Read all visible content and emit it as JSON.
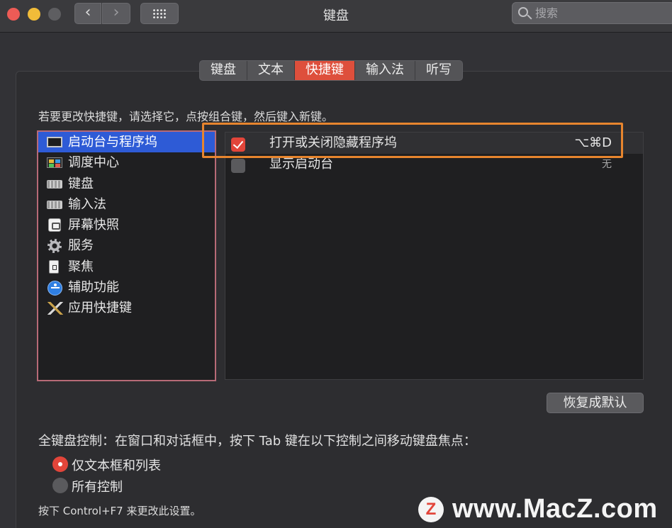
{
  "window": {
    "title": "键盘"
  },
  "search": {
    "placeholder": "搜索"
  },
  "tabs": [
    {
      "label": "键盘"
    },
    {
      "label": "文本"
    },
    {
      "label": "快捷键",
      "active": true
    },
    {
      "label": "输入法"
    },
    {
      "label": "听写"
    }
  ],
  "instruction": "若要更改快捷键，请选择它，点按组合键，然后键入新键。",
  "categories": [
    {
      "label": "启动台与程序坞",
      "icon": "launchpad-icon",
      "selected": true
    },
    {
      "label": "调度中心",
      "icon": "mission-control-icon"
    },
    {
      "label": "键盘",
      "icon": "keyboard-icon"
    },
    {
      "label": "输入法",
      "icon": "keyboard-icon"
    },
    {
      "label": "屏幕快照",
      "icon": "screenshot-icon"
    },
    {
      "label": "服务",
      "icon": "gear-icon"
    },
    {
      "label": "聚焦",
      "icon": "spotlight-icon"
    },
    {
      "label": "辅助功能",
      "icon": "accessibility-icon"
    },
    {
      "label": "应用快捷键",
      "icon": "app-shortcuts-icon"
    }
  ],
  "shortcuts": [
    {
      "label": "打开或关闭隐藏程序坞",
      "key": "⌥⌘D",
      "checked": true
    },
    {
      "label": "显示启动台",
      "key": "无",
      "checked": false
    }
  ],
  "restore_button": "恢复成默认",
  "keyboard_control": {
    "description": "全键盘控制：在窗口和对话框中，按下 Tab 键在以下控制之间移动键盘焦点：",
    "options": [
      {
        "label": "仅文本框和列表",
        "selected": true
      },
      {
        "label": "所有控制",
        "selected": false
      }
    ],
    "footnote": "按下 Control+F7 来更改此设置。"
  },
  "watermark": {
    "logo": "Z",
    "text": "www.MacZ.com"
  },
  "colors": {
    "accent": "#e2453a",
    "selection": "#2e5bd6",
    "highlight": "#e7852e"
  }
}
